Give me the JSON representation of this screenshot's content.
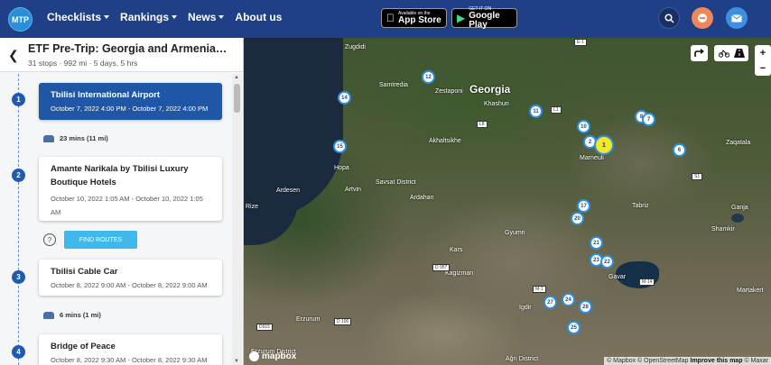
{
  "nav": {
    "logo": "MTP",
    "menu": [
      {
        "label": "Checklists",
        "dropdown": true
      },
      {
        "label": "Rankings",
        "dropdown": true
      },
      {
        "label": "News",
        "dropdown": true
      },
      {
        "label": "About us",
        "dropdown": false
      }
    ],
    "appstore": {
      "small": "Available on the",
      "big": "App Store"
    },
    "googleplay": {
      "small": "GET IT ON",
      "big": "Google Play"
    },
    "buttons": {
      "search_color": "#1f3f86",
      "minus_color": "#f0875a",
      "mail_color": "#3f8fe0"
    }
  },
  "trip": {
    "title": "ETF Pre-Trip: Georgia and Armenia…",
    "meta": "31 stops · 992 mi · 5 days, 5 hrs"
  },
  "stops": [
    {
      "num": "1",
      "name": "Tbilisi International Airport",
      "date": "October 7, 2022 4:00 PM - October 7, 2022 4:00 PM",
      "active": true
    },
    {
      "num": "2",
      "name": "Amante Narikala by Tbilisi Luxury Boutique Hotels",
      "date": "October 10, 2022 1:05 AM - October 10, 2022 1:05 AM",
      "active": false
    },
    {
      "num": "3",
      "name": "Tbilisi Cable Car",
      "date": "October 8, 2022 9:00 AM - October 8, 2022 9:00 AM",
      "active": false
    },
    {
      "num": "4",
      "name": "Bridge of Peace",
      "date": "October 8, 2022 9:30 AM - October 8, 2022 9:30 AM",
      "active": false
    }
  ],
  "drives": [
    {
      "label": "23 mins (11 mi)"
    },
    {
      "label": "6 mins (1 mi)"
    }
  ],
  "find_routes": "FIND ROUTES",
  "help_mark": "?",
  "map": {
    "labels": [
      {
        "text": "Georgia",
        "big": true
      },
      {
        "text": "Zugdidi"
      },
      {
        "text": "Samtredia"
      },
      {
        "text": "Zestaponi"
      },
      {
        "text": "Khashuri"
      },
      {
        "text": "Akhaltsikhe"
      },
      {
        "text": "Marneuli"
      },
      {
        "text": "Zaqatala"
      },
      {
        "text": "Hopa"
      },
      {
        "text": "Ardesen"
      },
      {
        "text": "Artvin"
      },
      {
        "text": "Savsat District"
      },
      {
        "text": "Ardahan"
      },
      {
        "text": "Rize"
      },
      {
        "text": "Tabriz"
      },
      {
        "text": "Gyumri"
      },
      {
        "text": "Kars"
      },
      {
        "text": "Kagizman"
      },
      {
        "text": "Igdir"
      },
      {
        "text": "Erzurum"
      },
      {
        "text": "Gavar"
      },
      {
        "text": "Ganja"
      },
      {
        "text": "Shamkir"
      },
      {
        "text": "Martakert"
      },
      {
        "text": "Erzurum District"
      },
      {
        "text": "Ağrı District"
      }
    ],
    "roads": [
      "D 957",
      "D 100",
      "D915",
      "M-14",
      "M-1",
      "E-1",
      "L8",
      "L1",
      "S1"
    ],
    "pins": [
      "12",
      "14",
      "15",
      "11",
      "10",
      "2",
      "1",
      "8",
      "7",
      "6",
      "17",
      "20",
      "21",
      "23",
      "22",
      "27",
      "24",
      "28",
      "25"
    ],
    "highlight_pin": "1",
    "logo": "mapbox",
    "attribution": {
      "a": "© Mapbox",
      "b": "© OpenStreetMap",
      "c": "Improve this map",
      "d": "© Maxar"
    },
    "controls": {
      "zoom_in": "+",
      "zoom_out": "−"
    }
  }
}
